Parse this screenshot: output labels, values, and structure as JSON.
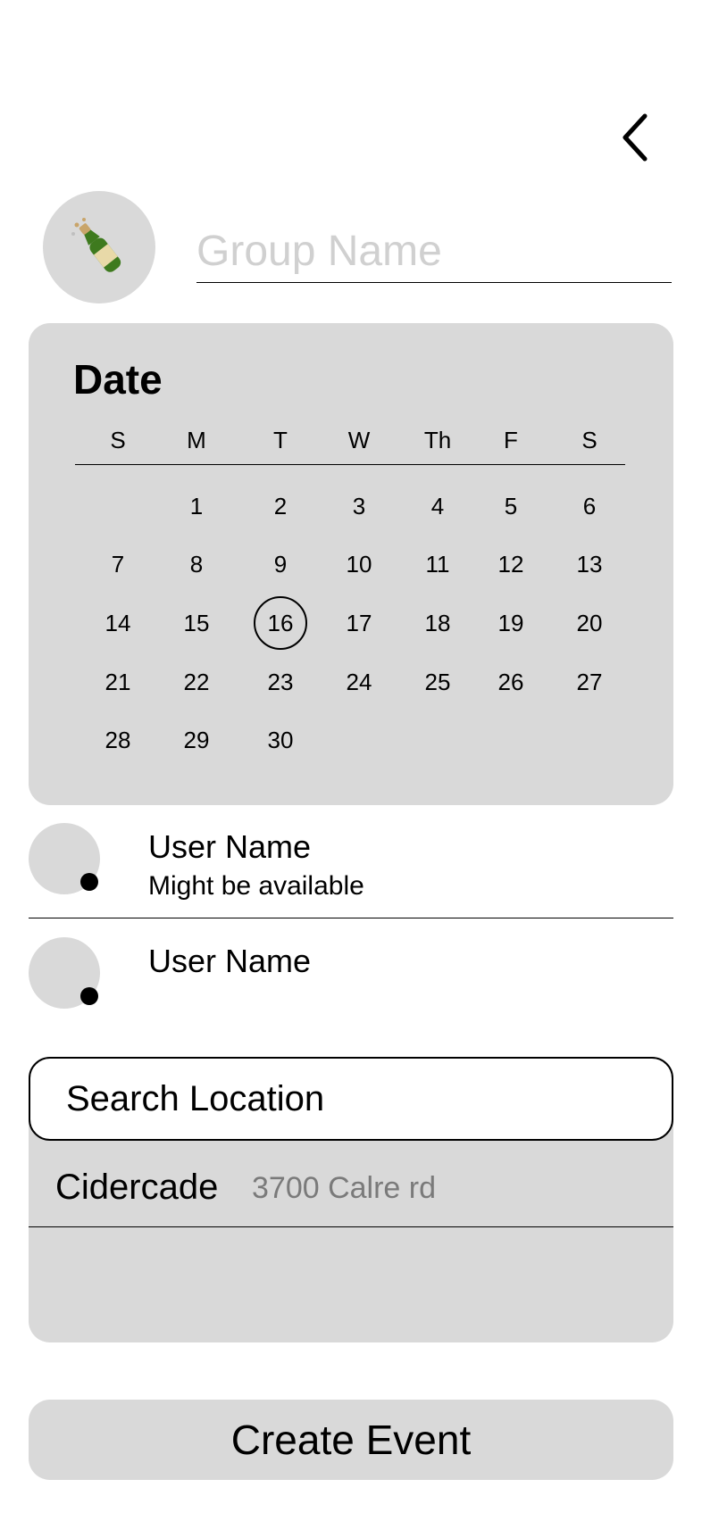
{
  "header": {
    "back_icon": "chevron-left-icon",
    "group_icon": "champagne-bottle-icon",
    "group_name_placeholder": "Group Name"
  },
  "calendar": {
    "title": "Date",
    "weekdays": [
      "S",
      "M",
      "T",
      "W",
      "Th",
      "F",
      "S"
    ],
    "days": [
      "1",
      "2",
      "3",
      "4",
      "5",
      "6",
      "7",
      "8",
      "9",
      "10",
      "11",
      "12",
      "13",
      "14",
      "15",
      "16",
      "17",
      "18",
      "19",
      "20",
      "21",
      "22",
      "23",
      "24",
      "25",
      "26",
      "27",
      "28",
      "29",
      "30"
    ],
    "first_weekday_index": 1,
    "selected_day": "16"
  },
  "users": [
    {
      "name": "User Name",
      "status": "Might be available"
    },
    {
      "name": "User Name",
      "status": ""
    }
  ],
  "location": {
    "search_placeholder": "Search Location",
    "results": [
      {
        "name": "Cidercade",
        "address": "3700 Calre rd"
      }
    ]
  },
  "actions": {
    "create_label": "Create Event"
  },
  "colors": {
    "panel": "#d9d9d9",
    "text": "#000000",
    "placeholder": "#d0d0d0",
    "muted": "#7a7a7a"
  }
}
